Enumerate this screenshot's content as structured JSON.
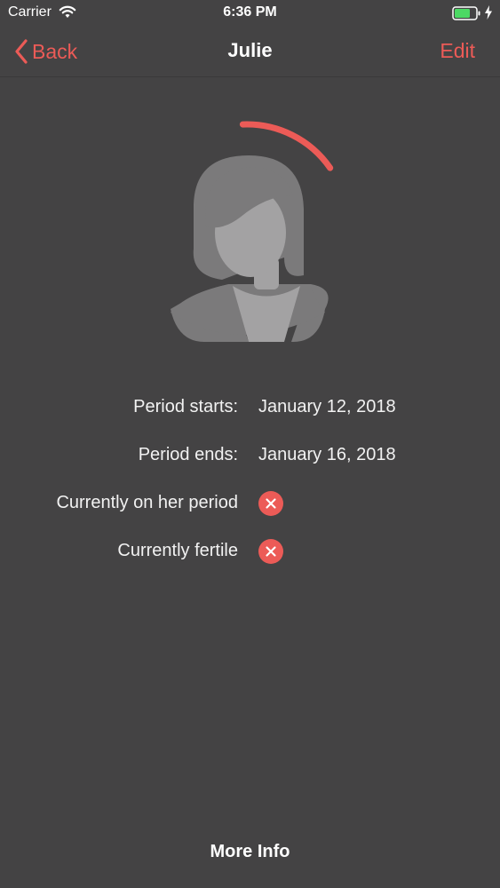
{
  "status_bar": {
    "carrier": "Carrier",
    "time": "6:36 PM"
  },
  "nav": {
    "back_label": "Back",
    "title": "Julie",
    "edit_label": "Edit"
  },
  "profile": {
    "cycle_progress_fraction": 0.16
  },
  "info": {
    "period_starts_label": "Period starts:",
    "period_starts_value": "January 12, 2018",
    "period_ends_label": "Period ends:",
    "period_ends_value": "January 16, 2018",
    "on_period_label": "Currently on her period",
    "on_period_status": "x-icon",
    "fertile_label": "Currently fertile",
    "fertile_status": "x-icon"
  },
  "footer": {
    "more_info_label": "More Info"
  },
  "colors": {
    "accent": "#ec5b57",
    "background": "#444344",
    "battery": "#4cd964"
  }
}
